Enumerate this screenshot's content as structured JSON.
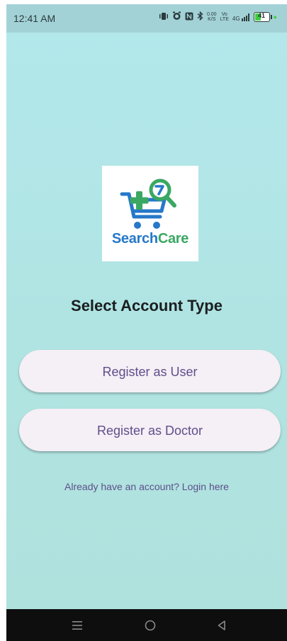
{
  "status_bar": {
    "time": "12:41 AM",
    "speed_value": "0.00",
    "speed_unit": "K/S",
    "volte_top": "Vo",
    "volte_bottom": "LTE",
    "network": "4G",
    "battery_level": "41"
  },
  "logo": {
    "word_part1": "Search",
    "word_part2": "Care",
    "colors": {
      "blue": "#2678c8",
      "green": "#3aa862"
    }
  },
  "main": {
    "title": "Select Account Type",
    "register_user_label": "Register as User",
    "register_doctor_label": "Register as Doctor",
    "login_link": "Already have an account? Login here"
  },
  "nav_bar": {
    "icons": [
      "menu-icon",
      "home-circle-icon",
      "back-triangle-icon"
    ]
  },
  "theme": {
    "accent_text": "#5e4f8a",
    "button_bg": "#f5eff6",
    "background": "#b3e8ec"
  }
}
